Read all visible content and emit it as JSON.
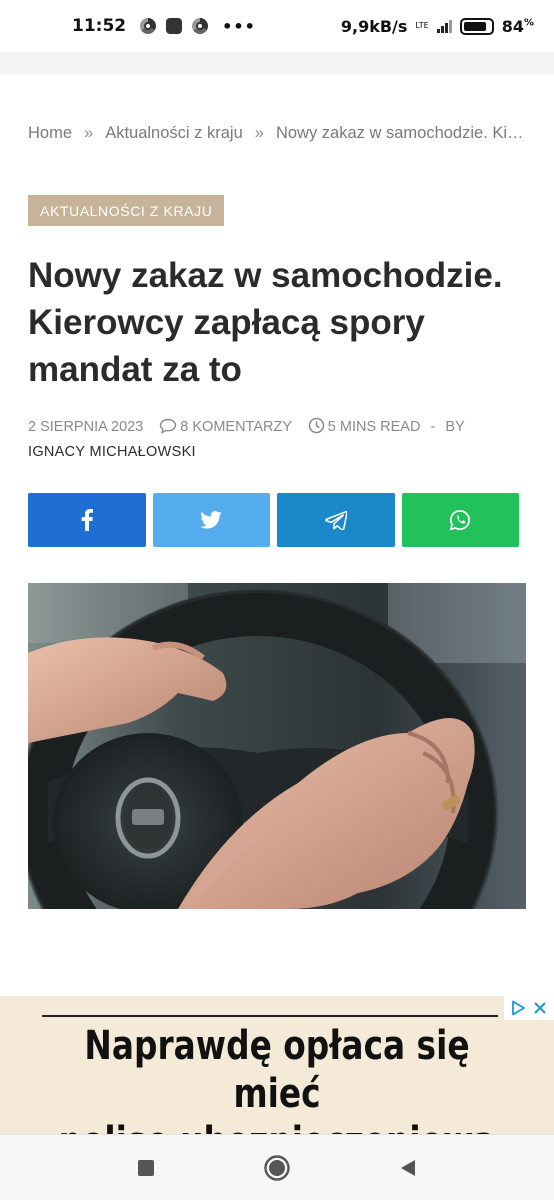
{
  "status_bar": {
    "time": "11:52",
    "dots": "•••",
    "speed": "9,9kB/s",
    "network": "LTE",
    "battery_pct": "84",
    "battery_unit": "%",
    "battery_level": 0.84
  },
  "breadcrumb": {
    "home": "Home",
    "sep": "»",
    "section": "Aktualności z kraju",
    "current": "Nowy zakaz w samochodzie. Kierowcy zapłacą spory mandat za to"
  },
  "article": {
    "category": "AKTUALNOŚCI Z KRAJU",
    "title": "Nowy zakaz w samochodzie. Kierowcy zapłacą spory mandat za to",
    "date": "2 SIERPNIA 2023",
    "comments": "8 KOMENTARZY",
    "read_time": "5 MINS READ",
    "dash": "-",
    "by": "BY",
    "author": "IGNACY MICHAŁOWSKI"
  },
  "share": {
    "colors": {
      "facebook": "#1f6ed4",
      "twitter": "#55acee",
      "telegram": "#1a88c9",
      "whatsapp": "#21c15c"
    },
    "icons": [
      "facebook-icon",
      "twitter-icon",
      "telegram-icon",
      "whatsapp-icon"
    ]
  },
  "ad": {
    "line1": "Naprawdę opłaca się mieć",
    "line2": "polisę ubezpieczeniową"
  },
  "colors": {
    "category_bg": "#c7b39a",
    "title": "#2b2b2b",
    "meta": "#8a8a8a"
  }
}
